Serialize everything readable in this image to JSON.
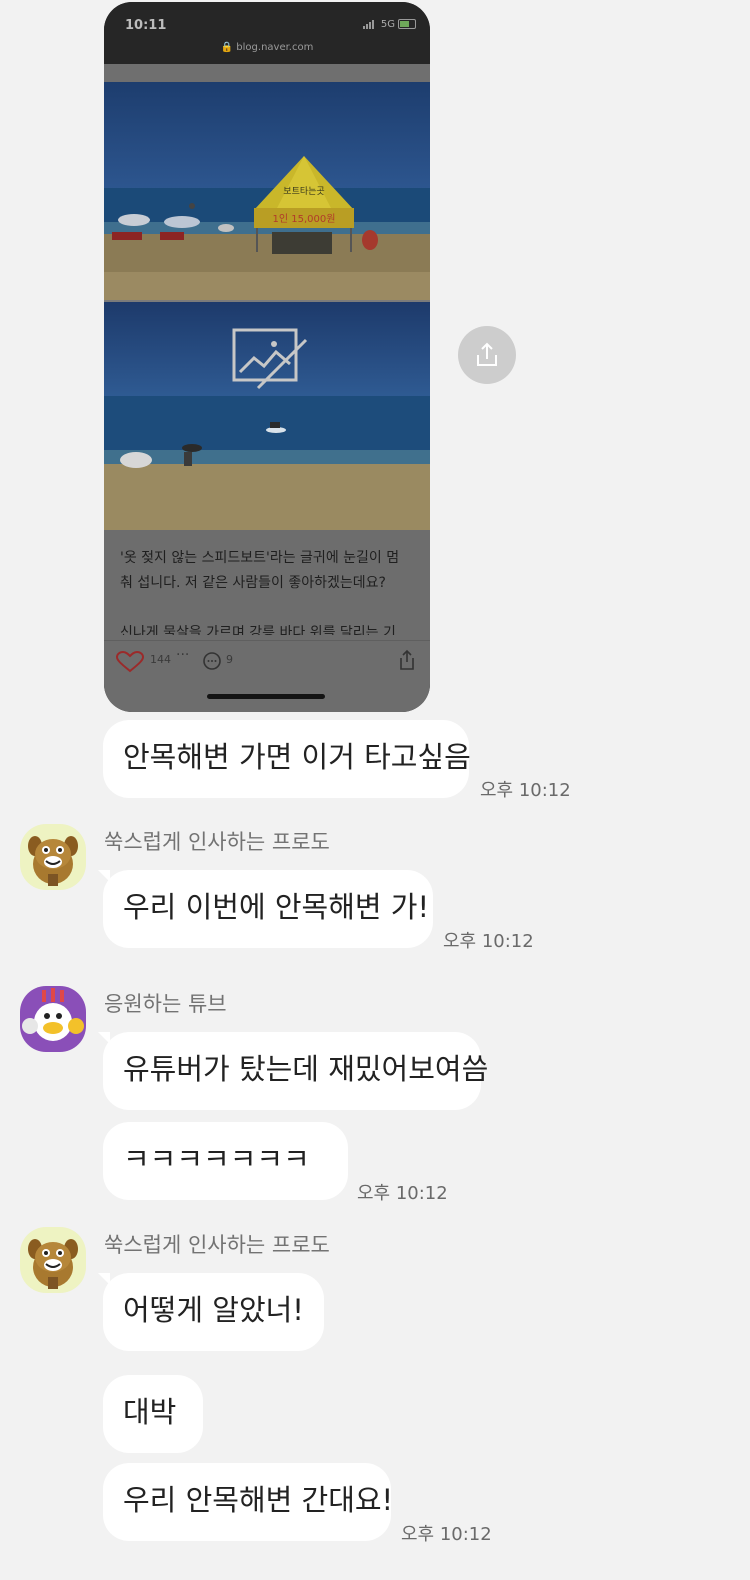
{
  "shared_post": {
    "status_time": "10:11",
    "network": "5G",
    "url": "blog.naver.com",
    "tent_sign": "보트타는곳",
    "tent_price": "1인 15,000원",
    "caption_lines": [
      "'옷 젖지 않는 스피드보트'라는 글귀에 눈길이 멈",
      "춰 섭니다. 저 같은 사람들이 좋아하겠는데요?",
      "신나게 물살을 가르며 강릉 바다 위를 달리는 기"
    ],
    "likes": "144",
    "comments": "9"
  },
  "messages": {
    "m1": {
      "text": "안목해변 가면 이거 타고싶음",
      "time": "오후 10:12"
    },
    "g1": {
      "sender": "쑥스럽게 인사하는 프로도",
      "text": "우리 이번에 안목해변 가!",
      "time": "오후 10:12"
    },
    "g2": {
      "sender": "응원하는 튜브",
      "text1": "유튜버가 탔는데 재밌어보여씀",
      "text2": "ㅋㅋㅋㅋㅋㅋㅋ",
      "time": "오후 10:12"
    },
    "g3": {
      "sender": "쑥스럽게 인사하는 프로도",
      "text1": "어떻게 알았너!",
      "text2": "대박",
      "text3": "우리 안목해변 간대요!",
      "time": "오후 10:12"
    }
  },
  "colors": {
    "background": "#f2f2f2",
    "bubble": "#ffffff",
    "tube_avatar": "#8a4fb8",
    "frodo_avatar": "#eef3c2"
  }
}
